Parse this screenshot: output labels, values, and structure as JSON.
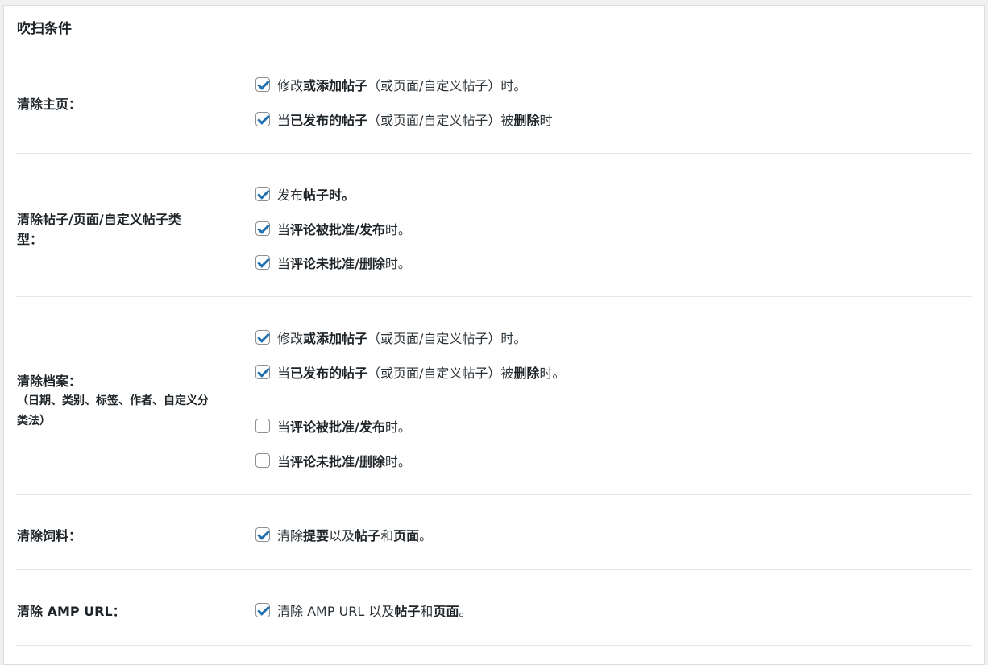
{
  "panel": {
    "title": "吹扫条件"
  },
  "sections": [
    {
      "label": "清除主页：",
      "options": [
        {
          "checked": true,
          "parts": [
            "修改",
            "或添加帖子",
            "（或页面/自定义帖子）时。"
          ]
        },
        {
          "checked": true,
          "parts": [
            "当",
            "已发布的帖子",
            "（或页面/自定义帖子）被",
            "删除",
            "时"
          ]
        }
      ]
    },
    {
      "label_line1": "清除帖子/页面/自定义帖子类",
      "label_line2": "型：",
      "options": [
        {
          "checked": true,
          "parts": [
            "发布",
            "帖子时。"
          ]
        },
        {
          "checked": true,
          "parts": [
            "当",
            "评论被批准/发布",
            "时。"
          ]
        },
        {
          "checked": true,
          "parts": [
            "当",
            "评论未批准/删除",
            "时。"
          ]
        }
      ]
    },
    {
      "label": "清除档案：",
      "sub_line1": "（日期、类别、标签、作者、自定义分",
      "sub_line2": "类法）",
      "options": [
        {
          "checked": true,
          "parts": [
            "修改",
            "或添加帖子",
            "（或页面/自定义帖子）时。"
          ]
        },
        {
          "checked": true,
          "parts": [
            "当",
            "已发布的帖子",
            "（或页面/自定义帖子）被",
            "删除",
            "时。"
          ]
        },
        {
          "checked": false,
          "parts": [
            "当",
            "评论被批准/发布",
            "时。"
          ]
        },
        {
          "checked": false,
          "parts": [
            "当",
            "评论未批准/删除",
            "时。"
          ]
        }
      ]
    },
    {
      "label": "清除饲料：",
      "options": [
        {
          "checked": true,
          "parts": [
            "清除",
            "提要",
            "以及",
            "帖子",
            "和",
            "页面",
            "。"
          ]
        }
      ]
    },
    {
      "label": "清除 AMP URL：",
      "options": [
        {
          "checked": true,
          "parts": [
            "清除 AMP URL 以及",
            "帖子",
            "和",
            "页面",
            "。"
          ]
        }
      ]
    }
  ]
}
